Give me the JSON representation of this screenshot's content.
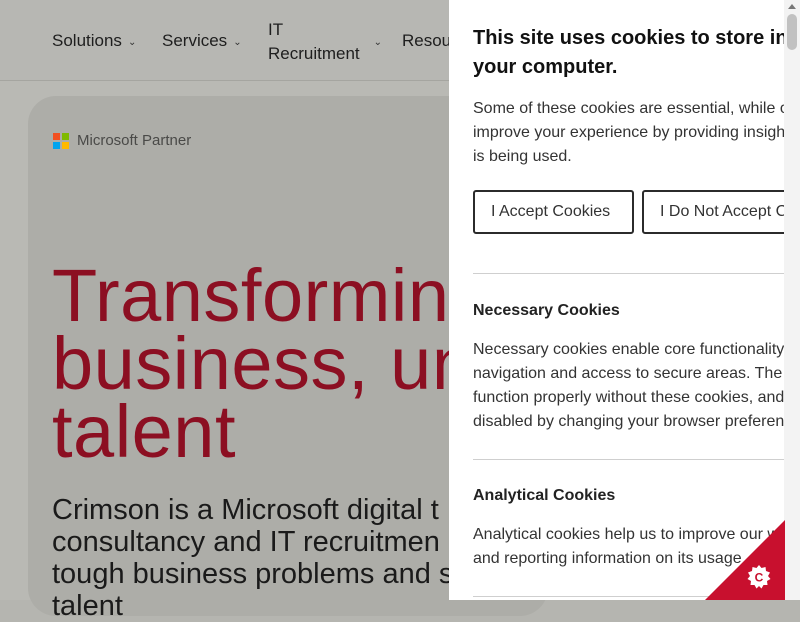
{
  "nav": {
    "items": [
      {
        "label": "Solutions"
      },
      {
        "label": "Services"
      },
      {
        "label": "IT\nRecruitment"
      },
      {
        "label": "Resou"
      }
    ]
  },
  "hero": {
    "partner_label": "Microsoft Partner",
    "title": "Transforming\nbusiness, unl\ntalent",
    "subtitle": "Crimson is a Microsoft digital t\nconsultancy and IT recruitmen\ntough business problems and s\ntalent"
  },
  "cookie_banner": {
    "title": "This site uses cookies to store infor\nyour computer.",
    "description": "Some of these cookies are essential, while o\nimprove your experience by providing insigh\nis being used.",
    "accept_label": "I Accept Cookies",
    "decline_label": "I Do Not Accept C",
    "sections": [
      {
        "title": "Necessary Cookies",
        "text": "Necessary cookies enable core functionality\nnavigation and access to secure areas. The\nfunction properly without these cookies, and\ndisabled by changing your browser preferen"
      },
      {
        "title": "Analytical Cookies",
        "text": "Analytical cookies help us to improve our w\nand reporting information on its usage"
      }
    ]
  },
  "colors": {
    "brand_red": "#c8102e",
    "title_red": "#8c0f22"
  },
  "icons": {
    "badge_icon": "cookie-settings-icon",
    "chevron": "chevron-down-icon"
  }
}
